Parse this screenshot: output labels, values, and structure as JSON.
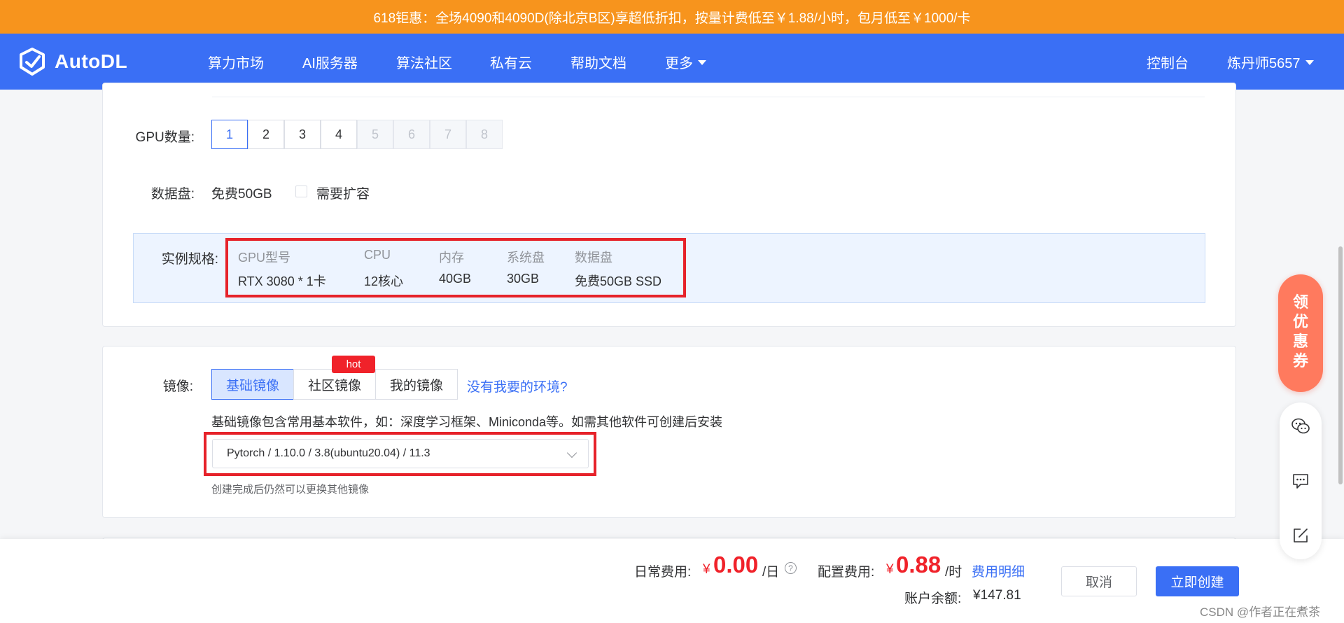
{
  "promo_banner": {
    "text": "618钜惠：全场4090和4090D(除北京B区)享超低折扣，按量计费低至￥1.88/小时，包月低至￥1000/卡"
  },
  "navbar": {
    "logo_text": "AutoDL",
    "items": [
      "算力市场",
      "AI服务器",
      "算法社区",
      "私有云",
      "帮助文档",
      "更多"
    ],
    "console_label": "控制台",
    "username": "炼丹师5657"
  },
  "gpu_count": {
    "label": "GPU数量:",
    "options": [
      "1",
      "2",
      "3",
      "4",
      "5",
      "6",
      "7",
      "8"
    ],
    "selected": "1"
  },
  "data_disk": {
    "label": "数据盘:",
    "value": "免费50GB",
    "expand_label": "需要扩容"
  },
  "instance_spec": {
    "label": "实例规格:",
    "headers": [
      "GPU型号",
      "CPU",
      "内存",
      "系统盘",
      "数据盘"
    ],
    "values": [
      "RTX 3080 * 1卡",
      "12核心",
      "40GB",
      "30GB",
      "免费50GB SSD"
    ]
  },
  "image": {
    "label": "镜像:",
    "tabs": [
      "基础镜像",
      "社区镜像",
      "我的镜像"
    ],
    "active_tab": "基础镜像",
    "hot_badge": "hot",
    "env_link": "没有我要的环境?",
    "description": "基础镜像包含常用基本软件，如：深度学习框架、Miniconda等。如需其他软件可创建后安装",
    "selected_image": "Pytorch / 1.10.0 / 3.8(ubuntu20.04) / 11.3",
    "hint": "创建完成后仍然可以更换其他镜像"
  },
  "footer": {
    "daily_fee_label": "日常费用:",
    "currency": "¥",
    "daily_fee": "0.00",
    "daily_unit": "/日",
    "help_icon": "?",
    "config_fee_label": "配置费用:",
    "config_fee": "0.88",
    "config_unit": "/时",
    "fee_detail_link": "费用明细",
    "balance_label": "账户余额:",
    "balance": "¥147.81",
    "cancel_label": "取消",
    "create_label": "立即创建"
  },
  "coupon": {
    "chars": [
      "领",
      "优",
      "惠",
      "券"
    ]
  },
  "watermark": "CSDN @作者正在煮茶",
  "colors": {
    "primary": "#3a6ff5",
    "promo": "#f7941d",
    "price": "#f0222a",
    "highlight_frame": "#e6222a"
  }
}
